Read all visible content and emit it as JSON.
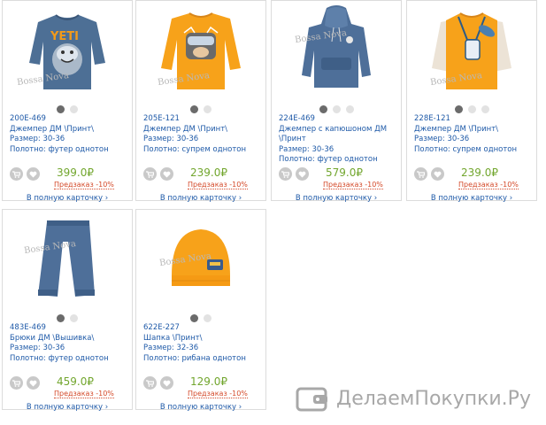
{
  "products": [
    {
      "sku": "200E-469",
      "name": "Джемпер ДМ \\Принт\\",
      "name2": "",
      "size": "Размер: 30-36",
      "fabric": "Полотно: футер однотон",
      "price": "399.0₽",
      "preorder": "Предзаказ -10%",
      "more": "В полную карточку ›",
      "item": "sweatshirt-yeti",
      "color": "#4d6f95"
    },
    {
      "sku": "205E-121",
      "name": "Джемпер ДМ \\Принт\\",
      "name2": "",
      "size": "Размер: 30-36",
      "fabric": "Полотно: супрем однотон",
      "price": "239.0₽",
      "preorder": "Предзаказ -10%",
      "more": "В полную карточку ›",
      "item": "longsleeve-orange",
      "color": "#f7a21a"
    },
    {
      "sku": "224E-469",
      "name": "Джемпер с капюшоном ДМ",
      "name2": "\\Принт",
      "size": "Размер: 30-36",
      "fabric": "Полотно: футер однотон",
      "price": "579.0₽",
      "preorder": "Предзаказ -10%",
      "more": "В полную карточку ›",
      "item": "hoodie-blue",
      "color": "#4e6f99"
    },
    {
      "sku": "228E-121",
      "name": "Джемпер ДМ \\Принт\\",
      "name2": "",
      "size": "Размер: 30-36",
      "fabric": "Полотно: супрем однотон",
      "price": "239.0₽",
      "preorder": "Предзаказ -10%",
      "more": "В полную карточку ›",
      "item": "longsleeve-two-tone",
      "color": "#f7a21a"
    },
    {
      "sku": "483E-469",
      "name": "Брюки ДМ \\Вышивка\\",
      "name2": "",
      "size": "Размер: 30-36",
      "fabric": "Полотно: футер однотон",
      "price": "459.0₽",
      "preorder": "Предзаказ -10%",
      "more": "В полную карточку ›",
      "item": "pants-blue",
      "color": "#4e6f99"
    },
    {
      "sku": "622E-227",
      "name": "Шапка \\Принт\\",
      "name2": "",
      "size": "Размер: 32-36",
      "fabric": "Полотно: рибана однотон",
      "price": "129.0₽",
      "preorder": "Предзаказ -10%",
      "more": "В полную карточку ›",
      "item": "hat-orange",
      "color": "#f7a21a"
    }
  ],
  "brand_mark": "Bossa Nova",
  "watermark": {
    "text": "ДелаемПокупки.Ру",
    "icon": "wallet-icon"
  }
}
